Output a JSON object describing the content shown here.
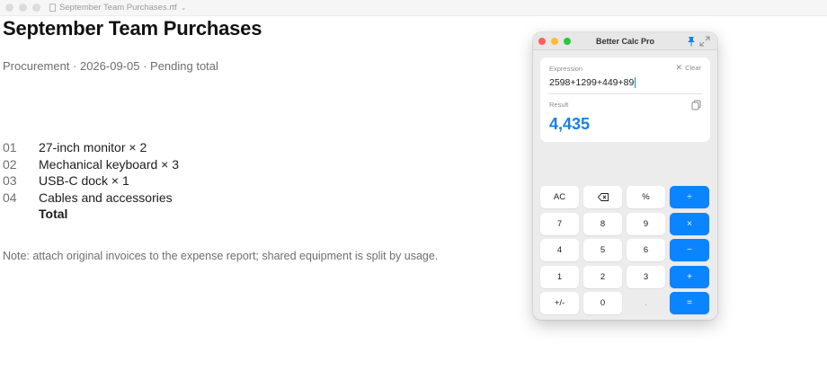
{
  "doc": {
    "window_title": "September Team Purchases.rtf",
    "heading": "September Team Purchases",
    "subline": "Procurement · 2026-09-05 · Pending total",
    "items": [
      {
        "num": "01",
        "text": "27-inch monitor × 2"
      },
      {
        "num": "02",
        "text": "Mechanical keyboard × 3"
      },
      {
        "num": "03",
        "text": "USB-C dock × 1"
      },
      {
        "num": "04",
        "text": "Cables and accessories"
      }
    ],
    "total_label": "Total",
    "note": "Note: attach original invoices to the expense report; shared equipment is split by usage."
  },
  "calculator": {
    "title": "Better Calc Pro",
    "expression_label": "Expression",
    "clear_label": "Clear",
    "expression": "2598+1299+449+89",
    "result_label": "Result",
    "result": "4,435",
    "accent_color": "#0a84ff",
    "keys": [
      [
        "AC",
        "backspace",
        "%",
        "÷"
      ],
      [
        "7",
        "8",
        "9",
        "×"
      ],
      [
        "4",
        "5",
        "6",
        "−"
      ],
      [
        "1",
        "2",
        "3",
        "+"
      ],
      [
        "+/-",
        "0",
        ".",
        "="
      ]
    ]
  }
}
